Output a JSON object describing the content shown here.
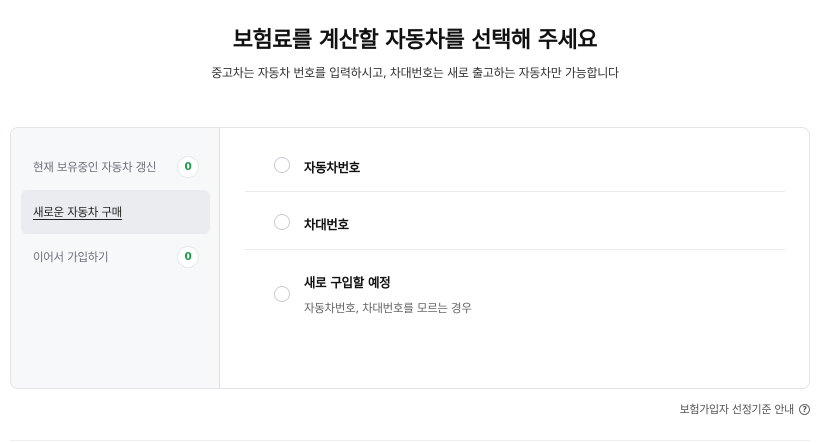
{
  "header": {
    "title": "보험료를 계산할 자동차를 선택해 주세요",
    "subtitle": "중고차는 자동차 번호를 입력하시고, 차대번호는 새로 출고하는 자동차만 가능합니다"
  },
  "sidebar": {
    "items": [
      {
        "label": "현재 보유중인 자동차 갱신",
        "count": "0",
        "active": false
      },
      {
        "label": "새로운 자동차 구매",
        "active": true
      },
      {
        "label": "이어서 가입하기",
        "count": "0",
        "active": false
      }
    ]
  },
  "options": [
    {
      "label": "자동차번호"
    },
    {
      "label": "차대번호"
    },
    {
      "label": "새로 구입할 예정",
      "description": "자동차번호, 차대번호를 모르는 경우"
    }
  ],
  "footer": {
    "guide_link": "보험가입자 선정기준 안내",
    "help_icon": "question-circle-icon"
  },
  "colors": {
    "badge_text": "#1f9a4b",
    "sidebar_bg": "#f7f8fa",
    "active_item_bg": "#ebecf0"
  }
}
